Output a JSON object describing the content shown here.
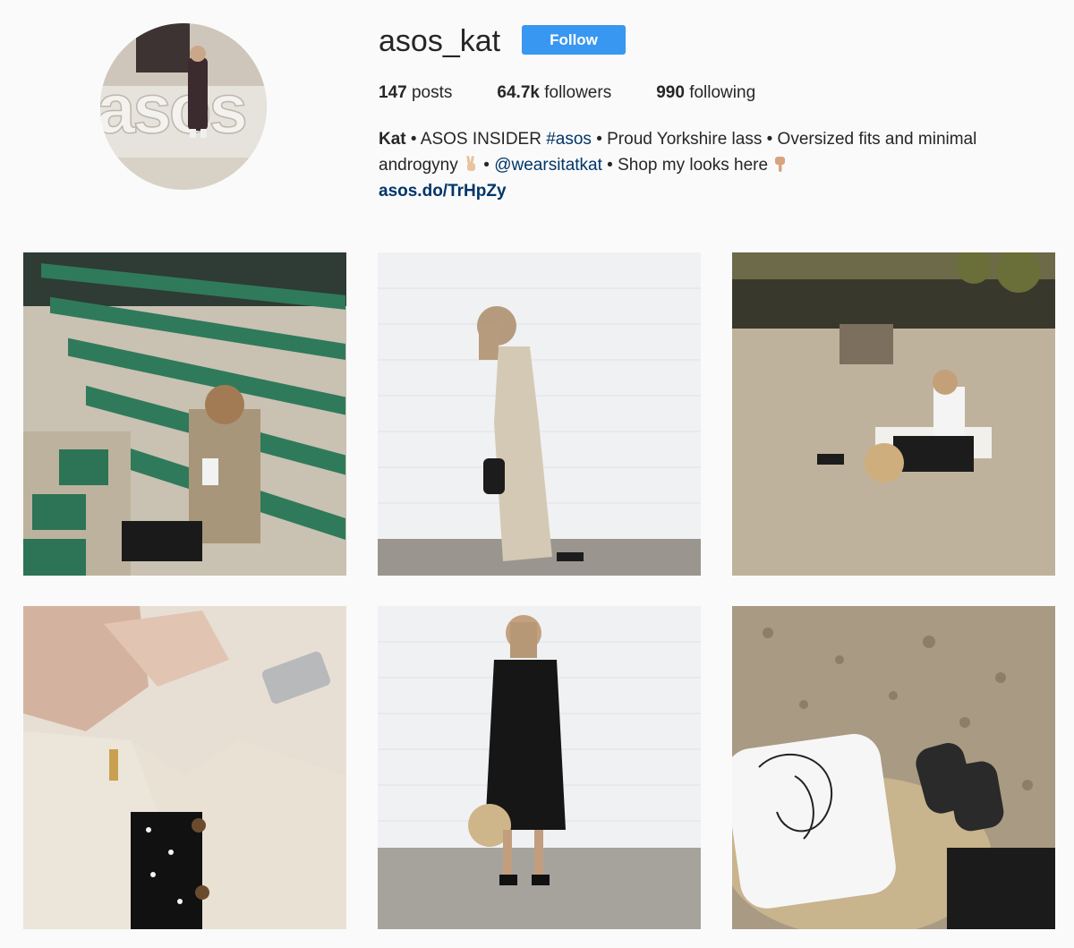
{
  "profile": {
    "username": "asos_kat",
    "follow_label": "Follow",
    "avatar_sign_text": "asos"
  },
  "stats": {
    "posts_count": "147",
    "posts_label": "posts",
    "followers_count": "64.7k",
    "followers_label": "followers",
    "following_count": "990",
    "following_label": "following"
  },
  "bio": {
    "name": "Kat",
    "text_1": " • ASOS INSIDER ",
    "hashtag": "#asos",
    "text_2": " • Proud Yorkshire lass • Oversized fits and minimal androgyny ",
    "text_3": " • ",
    "mention": "@wearsitatkat",
    "text_4": " • Shop my looks here ",
    "link": "asos.do/TrHpZy"
  },
  "icons": {
    "peace_hand": "victory-hand-emoji",
    "pointing_hand": "backhand-index-pointing-down-emoji"
  },
  "colors": {
    "follow_button": "#3897f0",
    "link": "#003569",
    "background": "#fafafa"
  }
}
